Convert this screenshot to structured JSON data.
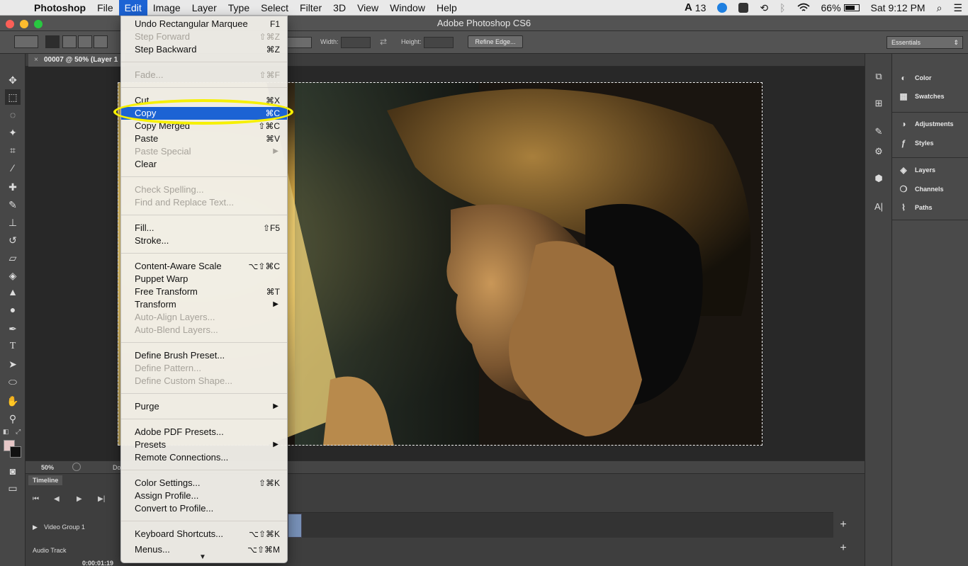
{
  "menubar": {
    "app": "Photoshop",
    "items": [
      "File",
      "Edit",
      "Image",
      "Layer",
      "Type",
      "Select",
      "Filter",
      "3D",
      "View",
      "Window",
      "Help"
    ],
    "status": {
      "adobe_count": "13",
      "battery": "66%",
      "clock": "Sat 9:12 PM"
    }
  },
  "window": {
    "title": "Adobe Photoshop CS6"
  },
  "options": {
    "width_label": "Width:",
    "height_label": "Height:",
    "refine_edge": "Refine Edge...",
    "workspace": "Essentials"
  },
  "document": {
    "tab_title": "00007 @ 50% (Layer 1",
    "zoom": "50%",
    "doc_label": "Do"
  },
  "timeline": {
    "title": "Timeline",
    "video_group": "Video Group 1",
    "audio_track": "Audio Track",
    "timecode": "0:00:01:19"
  },
  "panels": {
    "groups": [
      [
        "Color",
        "Swatches"
      ],
      [
        "Adjustments",
        "Styles"
      ],
      [
        "Layers",
        "Channels",
        "Paths"
      ]
    ]
  },
  "edit_menu": {
    "items": [
      {
        "label": "Undo Rectangular Marquee",
        "shortcut": "F1",
        "disabled": false
      },
      {
        "label": "Step Forward",
        "shortcut": "⇧⌘Z",
        "disabled": true
      },
      {
        "label": "Step Backward",
        "shortcut": "⌘Z",
        "disabled": false
      },
      {
        "label": "Fade...",
        "shortcut": "⇧⌘F",
        "disabled": true
      },
      {
        "label": "Cut",
        "shortcut": "⌘X",
        "disabled": false
      },
      {
        "label": "Copy",
        "shortcut": "⌘C",
        "disabled": false,
        "highlighted": true
      },
      {
        "label": "Copy Merged",
        "shortcut": "⇧⌘C",
        "disabled": false
      },
      {
        "label": "Paste",
        "shortcut": "⌘V",
        "disabled": false
      },
      {
        "label": "Paste Special",
        "shortcut": "",
        "disabled": true,
        "submenu": true
      },
      {
        "label": "Clear",
        "shortcut": "",
        "disabled": false
      },
      {
        "label": "Check Spelling...",
        "shortcut": "",
        "disabled": true
      },
      {
        "label": "Find and Replace Text...",
        "shortcut": "",
        "disabled": true
      },
      {
        "label": "Fill...",
        "shortcut": "⇧F5",
        "disabled": false
      },
      {
        "label": "Stroke...",
        "shortcut": "",
        "disabled": false
      },
      {
        "label": "Content-Aware Scale",
        "shortcut": "⌥⇧⌘C",
        "disabled": false
      },
      {
        "label": "Puppet Warp",
        "shortcut": "",
        "disabled": false
      },
      {
        "label": "Free Transform",
        "shortcut": "⌘T",
        "disabled": false
      },
      {
        "label": "Transform",
        "shortcut": "",
        "disabled": false,
        "submenu": true
      },
      {
        "label": "Auto-Align Layers...",
        "shortcut": "",
        "disabled": true
      },
      {
        "label": "Auto-Blend Layers...",
        "shortcut": "",
        "disabled": true
      },
      {
        "label": "Define Brush Preset...",
        "shortcut": "",
        "disabled": false
      },
      {
        "label": "Define Pattern...",
        "shortcut": "",
        "disabled": true
      },
      {
        "label": "Define Custom Shape...",
        "shortcut": "",
        "disabled": true
      },
      {
        "label": "Purge",
        "shortcut": "",
        "disabled": false,
        "submenu": true
      },
      {
        "label": "Adobe PDF Presets...",
        "shortcut": "",
        "disabled": false
      },
      {
        "label": "Presets",
        "shortcut": "",
        "disabled": false,
        "submenu": true
      },
      {
        "label": "Remote Connections...",
        "shortcut": "",
        "disabled": false
      },
      {
        "label": "Color Settings...",
        "shortcut": "⇧⌘K",
        "disabled": false
      },
      {
        "label": "Assign Profile...",
        "shortcut": "",
        "disabled": false
      },
      {
        "label": "Convert to Profile...",
        "shortcut": "",
        "disabled": false
      },
      {
        "label": "Keyboard Shortcuts...",
        "shortcut": "⌥⇧⌘K",
        "disabled": false
      },
      {
        "label": "Menus...",
        "shortcut": "⌥⇧⌘M",
        "disabled": false
      }
    ]
  },
  "colors": {
    "highlight": "#1c63d4",
    "annotation": "#f6f000",
    "foreground": "#e7c7c7",
    "background": "#111111"
  }
}
